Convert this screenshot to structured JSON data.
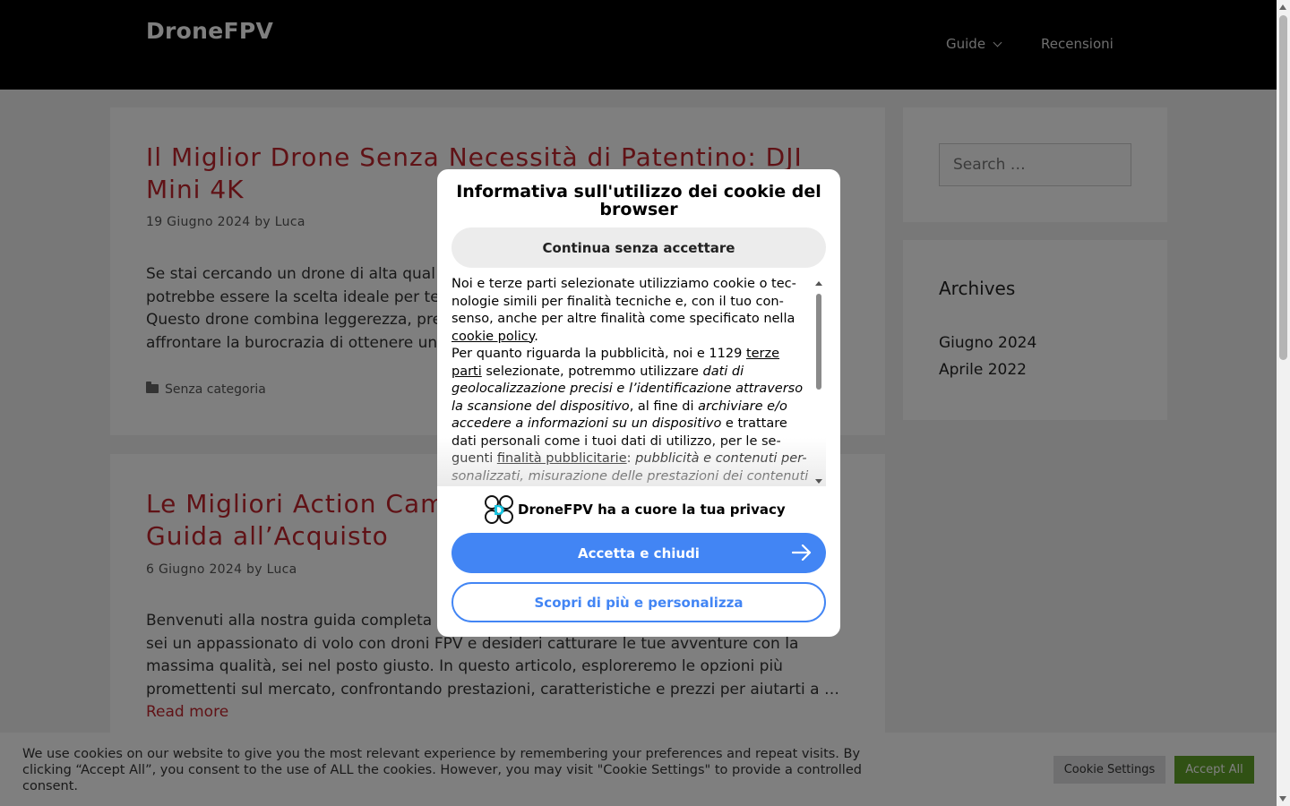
{
  "header": {
    "site_title": "DroneFPV",
    "nav": [
      {
        "label": "Guide"
      },
      {
        "label": "Recensioni"
      }
    ]
  },
  "posts": [
    {
      "title": "Il Miglior Drone Senza Necessità di Patentino: DJI Mini 4K",
      "date": "19 Giugno 2024",
      "by": "by",
      "author": "Luca",
      "excerpt_lines": [
        "Se stai cercando un drone di alta qual",
        "potrebbe essere la scelta ideale per te",
        "Questo drone combina leggerezza, pre",
        "affrontare la burocrazia di ottenere un"
      ],
      "category": "Senza categoria"
    },
    {
      "title": "Le Migliori Action Cam",
      "title_line2": "Guida all’Acquisto",
      "date": "6 Giugno 2024",
      "by": "by",
      "author": "Luca",
      "excerpt_lines": [
        "Benvenuti alla nostra guida completa",
        "sei un appassionato di volo con droni FPV e desideri catturare le tue avventure con la",
        "massima qualità, sei nel posto giusto. In questo articolo, esploreremo le opzioni più",
        "promettenti sul mercato, confrontando prestazioni, caratteristiche e prezzi per aiutarti a …"
      ],
      "read_more": "Read more"
    }
  ],
  "sidebar": {
    "search_placeholder": "Search …",
    "archives_title": "Archives",
    "archives": [
      "Giugno 2024",
      "Aprile 2022"
    ]
  },
  "modal": {
    "title": "Informativa sull'utilizzo dei cookie del browser",
    "continue_label": "Continua senza accettare",
    "body": {
      "p1_a": "Noi e terze parti selezionate utilizziamo cookie o tec-nologie simili per finalità tecniche e, con il tuo con-senso, anche per altre finalità come specificato nella ",
      "p1_link": "cookie policy",
      "p1_end": ".",
      "p2_a": "Per quanto riguarda la pubblicità, noi e 1129 ",
      "p2_link1": "terze parti",
      "p2_b": " selezionate, potremmo utilizzare ",
      "p2_i1": "dati di geolocalizzazione precisi e l’identificazione attraverso la scansione del dispositivo",
      "p2_c": ", al fine di ",
      "p2_i2": "archiviare e/o accedere a informazioni su un dispositivo",
      "p2_d": " e trattare dati personali come i tuoi dati di utilizzo, per le se-guenti ",
      "p2_link2": "finalità pubblicitarie",
      "p2_e": ": ",
      "p2_i3": "pubblicità e contenuti per-sonalizzati, misurazione delle prestazioni dei contenuti"
    },
    "privacy_text": "DroneFPV ha a cuore la tua privacy",
    "logo_letter": "D",
    "accept_label": "Accetta e chiudi",
    "learn_more_label": "Scopri di più e personalizza",
    "accent_color": "#4285f4"
  },
  "cookie_bar": {
    "text": "We use cookies on our website to give you the most relevant experience by remembering your preferences and repeat visits. By clicking “Accept All”, you consent to the use of ALL the cookies. However, you may visit \"Cookie Settings\" to provide a controlled consent.",
    "settings_label": "Cookie Settings",
    "accept_all_label": "Accept All",
    "accept_color": "#61a229"
  },
  "colors": {
    "link_red": "#c0252c",
    "header_bg": "#000000"
  }
}
